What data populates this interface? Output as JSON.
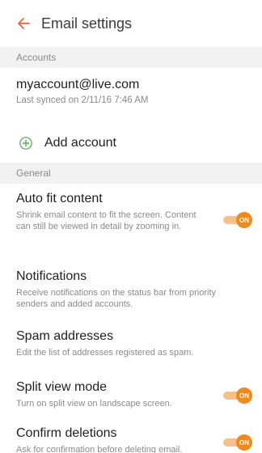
{
  "header": {
    "title": "Email settings",
    "back_icon": "arrow-left-icon",
    "accent": "#e8663d"
  },
  "sections": {
    "accounts": "Accounts",
    "general": "General"
  },
  "account": {
    "email": "myaccount@live.com",
    "last_synced": "Last synced on 2/11/16 7:46 AM"
  },
  "add_account": {
    "label": "Add account",
    "icon": "plus-icon",
    "icon_color": "#4caf50"
  },
  "settings": [
    {
      "title": "Auto fit content",
      "desc": "Shrink email content to fit the screen. Content can still be viewed in detail by zooming in.",
      "toggle": "ON"
    },
    {
      "title": "Notifications",
      "desc": "Receive notifications on the status bar from priority senders and added accounts."
    },
    {
      "title": "Spam addresses",
      "desc": "Edit the list of addresses registered as spam."
    },
    {
      "title": "Split view mode",
      "desc": "Turn on split view on landscape screen.",
      "toggle": "ON"
    },
    {
      "title": "Confirm deletions",
      "desc": "Ask for confirmation before deleting email.",
      "toggle": "ON"
    }
  ],
  "colors": {
    "toggle_on": "#f08a1e",
    "toggle_track": "#f6c189"
  }
}
